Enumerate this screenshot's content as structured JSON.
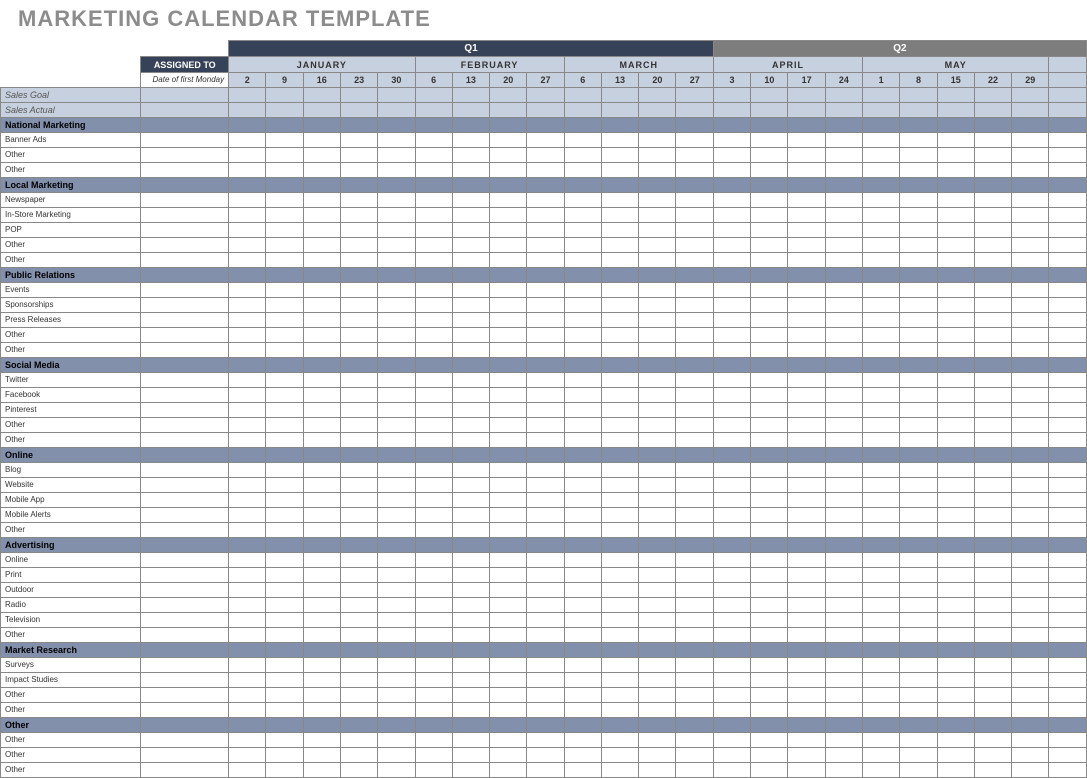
{
  "title": "MARKETING CALENDAR TEMPLATE",
  "assigned_to": "ASSIGNED TO",
  "date_label": "Date of first Monday",
  "quarters": [
    {
      "name": "Q1",
      "style": "dark",
      "months": [
        {
          "name": "JANUARY",
          "weeks": [
            "2",
            "9",
            "16",
            "23",
            "30"
          ]
        },
        {
          "name": "FEBRUARY",
          "weeks": [
            "6",
            "13",
            "20",
            "27"
          ]
        },
        {
          "name": "MARCH",
          "weeks": [
            "6",
            "13",
            "20",
            "27"
          ]
        }
      ]
    },
    {
      "name": "Q2",
      "style": "grey",
      "months": [
        {
          "name": "APRIL",
          "weeks": [
            "3",
            "10",
            "17",
            "24"
          ]
        },
        {
          "name": "MAY",
          "weeks": [
            "1",
            "8",
            "15",
            "22",
            "29"
          ]
        },
        {
          "name": "",
          "weeks": [
            ""
          ]
        }
      ]
    }
  ],
  "sales_rows": [
    "Sales Goal",
    "Sales Actual"
  ],
  "categories": [
    {
      "name": "National Marketing",
      "items": [
        "Banner Ads",
        "Other",
        "Other"
      ]
    },
    {
      "name": "Local Marketing",
      "items": [
        "Newspaper",
        "In-Store Marketing",
        "POP",
        "Other",
        "Other"
      ]
    },
    {
      "name": "Public Relations",
      "items": [
        "Events",
        "Sponsorships",
        "Press Releases",
        "Other",
        "Other"
      ]
    },
    {
      "name": "Social Media",
      "items": [
        "Twitter",
        "Facebook",
        "Pinterest",
        "Other",
        "Other"
      ]
    },
    {
      "name": "Online",
      "items": [
        "Blog",
        "Website",
        "Mobile App",
        "Mobile Alerts",
        "Other"
      ]
    },
    {
      "name": "Advertising",
      "items": [
        "Online",
        "Print",
        "Outdoor",
        "Radio",
        "Television",
        "Other"
      ]
    },
    {
      "name": "Market Research",
      "items": [
        "Surveys",
        "Impact Studies",
        "Other",
        "Other"
      ]
    },
    {
      "name": "Other",
      "items": [
        "Other",
        "Other",
        "Other"
      ]
    }
  ]
}
